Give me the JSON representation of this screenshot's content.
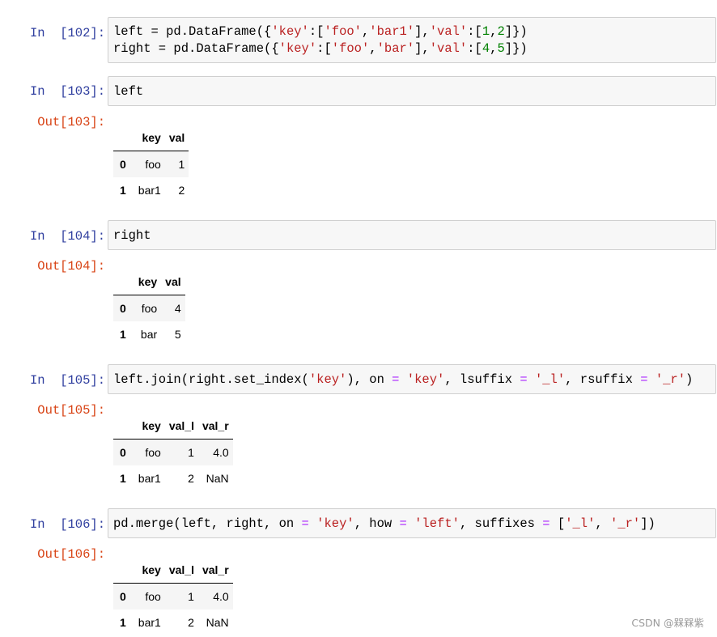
{
  "cells": [
    {
      "in_prompt": "In  [102]:",
      "out_prompt": "",
      "code_lines": [
        [
          "left = pd.DataFrame({",
          "'key'",
          ":[",
          "'foo'",
          ",",
          "'bar1'",
          "],",
          "'val'",
          ":[",
          "1",
          ",",
          "2",
          "]})"
        ],
        [
          "right = pd.DataFrame({",
          "'key'",
          ":[",
          "'foo'",
          ",",
          "'bar'",
          "],",
          "'val'",
          ":[",
          "4",
          ",",
          "5",
          "]})"
        ]
      ]
    },
    {
      "in_prompt": "In  [103]:",
      "code": "left",
      "out_prompt": "Out[103]:",
      "table": {
        "columns": [
          "key",
          "val"
        ],
        "rows": [
          {
            "index": "0",
            "cells": [
              "foo",
              "1"
            ]
          },
          {
            "index": "1",
            "cells": [
              "bar1",
              "2"
            ]
          }
        ]
      }
    },
    {
      "in_prompt": "In  [104]:",
      "code": "right",
      "out_prompt": "Out[104]:",
      "table": {
        "columns": [
          "key",
          "val"
        ],
        "rows": [
          {
            "index": "0",
            "cells": [
              "foo",
              "4"
            ]
          },
          {
            "index": "1",
            "cells": [
              "bar",
              "5"
            ]
          }
        ]
      }
    },
    {
      "in_prompt": "In  [105]:",
      "code_parts": [
        "left.join(right.set_index(",
        "'key'",
        "), on ",
        "=",
        " ",
        "'key'",
        ", lsuffix ",
        "=",
        " ",
        "'_l'",
        ", rsuffix ",
        "=",
        " ",
        "'_r'",
        ")"
      ],
      "out_prompt": "Out[105]:",
      "table": {
        "columns": [
          "key",
          "val_l",
          "val_r"
        ],
        "rows": [
          {
            "index": "0",
            "cells": [
              "foo",
              "1",
              "4.0"
            ]
          },
          {
            "index": "1",
            "cells": [
              "bar1",
              "2",
              "NaN"
            ]
          }
        ]
      }
    },
    {
      "in_prompt": "In  [106]:",
      "code_parts": [
        "pd.merge(left, right, on ",
        "=",
        " ",
        "'key'",
        ", how ",
        "=",
        " ",
        "'left'",
        ", suffixes ",
        "=",
        " [",
        "'_l'",
        ", ",
        "'_r'",
        "])"
      ],
      "out_prompt": "Out[106]:",
      "table": {
        "columns": [
          "key",
          "val_l",
          "val_r"
        ],
        "rows": [
          {
            "index": "0",
            "cells": [
              "foo",
              "1",
              "4.0"
            ]
          },
          {
            "index": "1",
            "cells": [
              "bar1",
              "2",
              "NaN"
            ]
          }
        ]
      }
    }
  ],
  "watermark": "CSDN @槑槑紫",
  "colors": {
    "in_prompt": "#303f9f",
    "out_prompt": "#d84315",
    "string": "#ba2121",
    "operator": "#aa22ff",
    "number": "#008000",
    "cell_bg": "#f7f7f7"
  }
}
